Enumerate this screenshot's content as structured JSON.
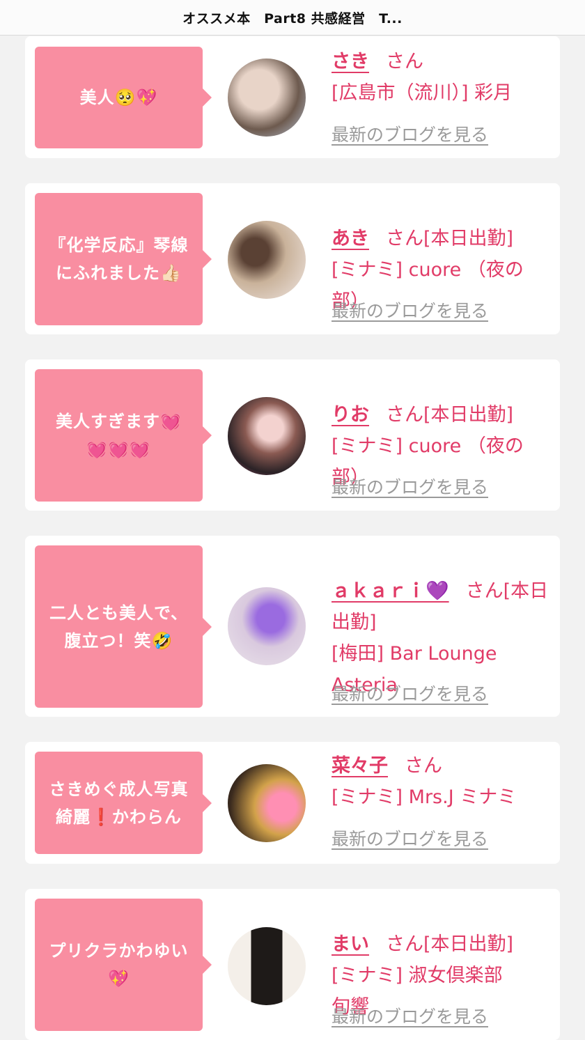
{
  "header": {
    "title": "オススメ本　Part8 共感経営　T..."
  },
  "blog_link_label": "最新のブログを見る",
  "accent_color": "#e13b67",
  "bubble_color": "#f98ea1",
  "cards": [
    {
      "comment": "美人🥺💖",
      "name": "さき",
      "suffix": "さん",
      "shop": "[広島市（流川）] 彩月"
    },
    {
      "comment": "『化学反応』琴線\nにふれました👍🏻",
      "name": "あき",
      "suffix": "さん[本日出勤]",
      "shop": "[ミナミ] cuore （夜の\n部）"
    },
    {
      "comment": "美人すぎます💓\n💓💓💓",
      "name": "りお",
      "suffix": "さん[本日出勤]",
      "shop": "[ミナミ] cuore （夜の\n部）"
    },
    {
      "comment": "二人とも美人で、\n腹立つ！笑🤣",
      "name": "ａｋａｒｉ💜",
      "suffix": "さん[本日出勤]",
      "shop": "[梅田] Bar Lounge\nAsteria"
    },
    {
      "comment": "さきめぐ成人写真\n綺麗❗️かわらん",
      "name": "菜々子",
      "suffix": "さん",
      "shop": "[ミナミ] Mrs.J ミナミ"
    },
    {
      "comment": "プリクラかわゆい\n💖",
      "name": "まい",
      "suffix": "さん[本日出勤]",
      "shop": "[ミナミ] 淑女倶楽部\n旬響"
    }
  ]
}
